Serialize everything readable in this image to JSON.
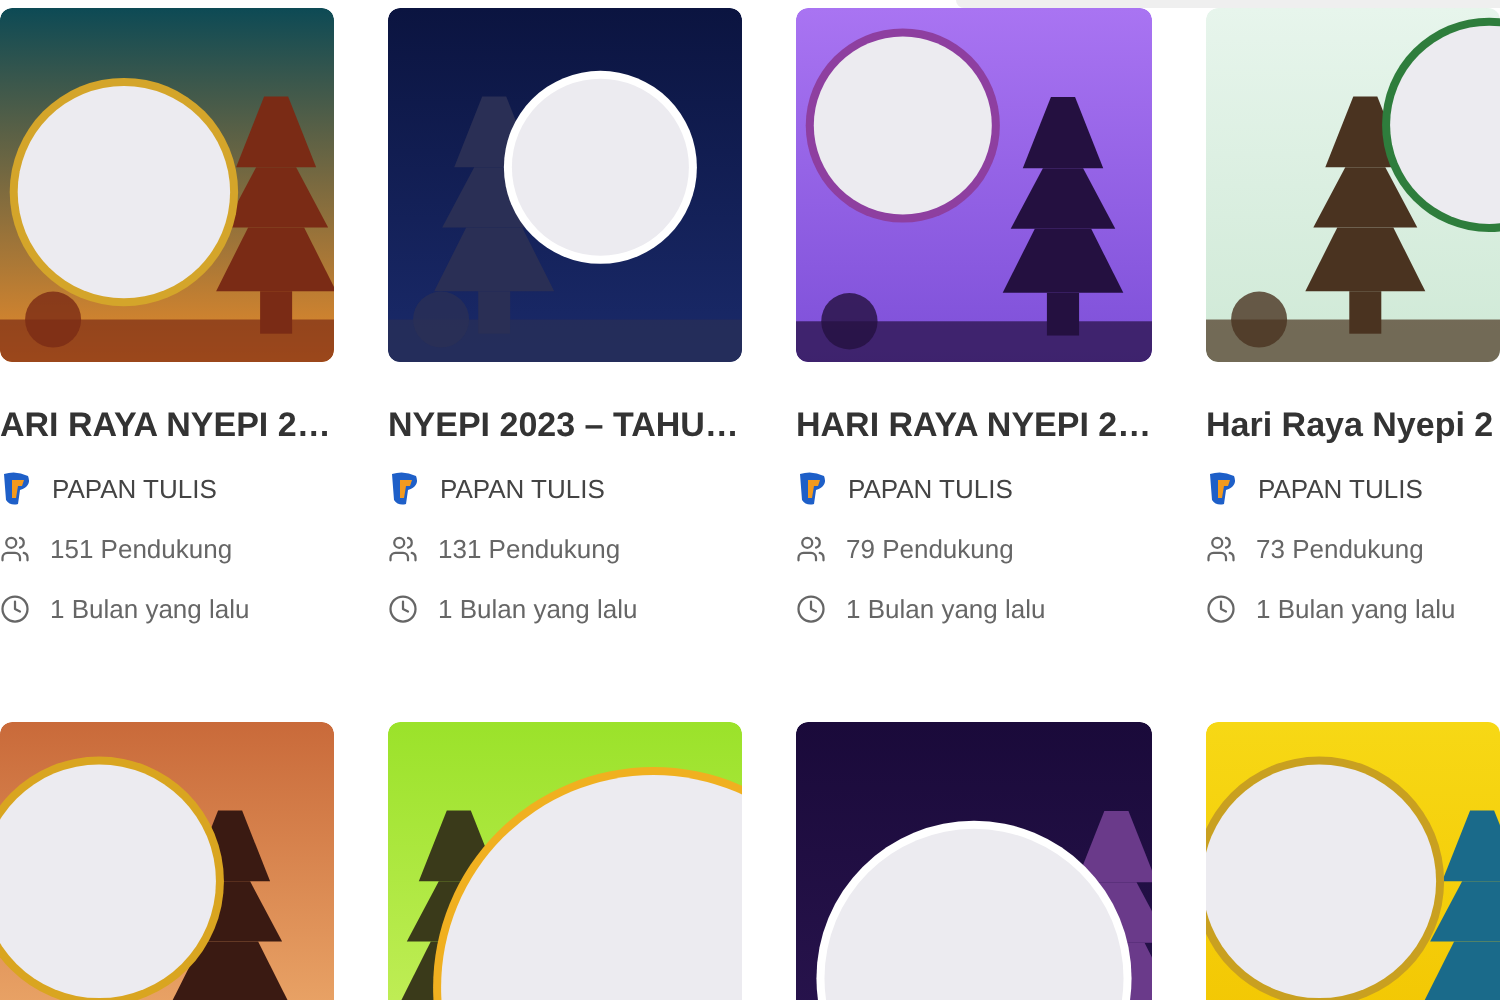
{
  "cards": [
    {
      "kind": "campaign",
      "title": "ARI RAYA NYEPI 2…",
      "publisher": "PAPAN TULIS",
      "supporters": "151 Pendukung",
      "time": "1 Bulan yang lalu"
    },
    {
      "kind": "campaign",
      "title": "NYEPI 2023 – TAHU…",
      "publisher": "PAPAN TULIS",
      "supporters": "131 Pendukung",
      "time": "1 Bulan yang lalu"
    },
    {
      "kind": "campaign",
      "title": "HARI RAYA NYEPI 2…",
      "publisher": "PAPAN TULIS",
      "supporters": "79 Pendukung",
      "time": "1 Bulan yang lalu"
    },
    {
      "kind": "campaign",
      "title": "Hari Raya Nyepi 2",
      "publisher": "PAPAN TULIS",
      "supporters": "73 Pendukung",
      "time": "1 Bulan yang lalu"
    },
    {
      "kind": "picture"
    },
    {
      "kind": "picture"
    },
    {
      "kind": "picture"
    },
    {
      "kind": "picture"
    }
  ]
}
